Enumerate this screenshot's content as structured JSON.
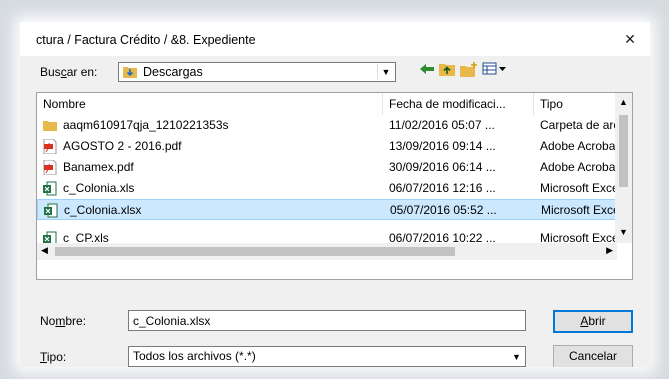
{
  "window": {
    "title": "ctura / Factura Crédito / &8. Expediente",
    "close": "✕"
  },
  "toolbar": {
    "lookin_label_pre": "Bus",
    "lookin_label_u": "c",
    "lookin_label_post": "ar en:",
    "lookin_value": "Descargas",
    "dropdown_glyph": "▼"
  },
  "columns": {
    "name": "Nombre",
    "date": "Fecha de modificaci...",
    "type": "Tipo"
  },
  "files": [
    {
      "name": "aaqm610917qja_1210221353s",
      "date": "11/02/2016 05:07 ...",
      "type": "Carpeta de arch",
      "icon": "folder-icon"
    },
    {
      "name": "AGOSTO 2  - 2016.pdf",
      "date": "13/09/2016 09:14 ...",
      "type": "Adobe Acrobat",
      "icon": "pdf-icon"
    },
    {
      "name": "Banamex.pdf",
      "date": "30/09/2016 06:14 ...",
      "type": "Adobe Acrobat",
      "icon": "pdf-icon"
    },
    {
      "name": "c_Colonia.xls",
      "date": "06/07/2016 12:16 ...",
      "type": "Microsoft Excel",
      "icon": "excel-icon"
    },
    {
      "name": "c_Colonia.xlsx",
      "date": "05/07/2016 05:52 ...",
      "type": "Microsoft Excel",
      "icon": "excel-icon",
      "selected": true
    },
    {
      "name": "c_CP.xls",
      "date": "06/07/2016 10:22 ...",
      "type": "Microsoft Excel",
      "icon": "excel-icon"
    }
  ],
  "filename": {
    "label_pre": "No",
    "label_u": "m",
    "label_post": "bre:",
    "value": "c_Colonia.xlsx"
  },
  "filetype": {
    "label_u": "T",
    "label_post": "ipo:",
    "value": "Todos los archivos (*.*)"
  },
  "buttons": {
    "open_u": "A",
    "open_post": "brir",
    "cancel": "Cancelar"
  },
  "colors": {
    "selection": "#cce8ff",
    "accent": "#0078d7",
    "folder": "#e8b84a",
    "pdf": "#d93025",
    "excel": "#1e7145"
  }
}
